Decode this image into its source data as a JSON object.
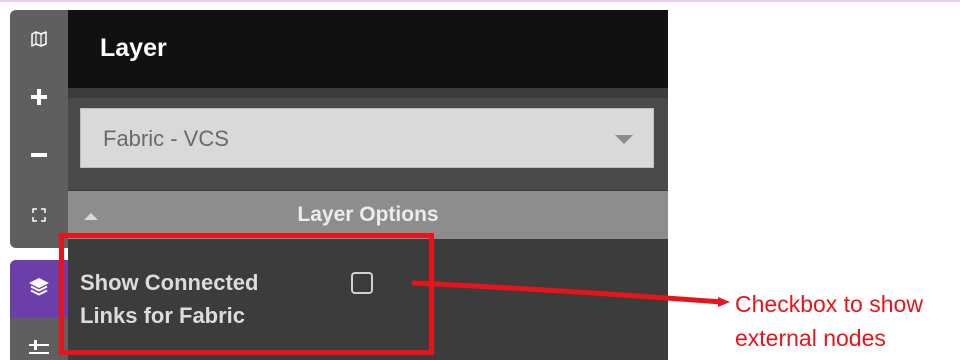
{
  "toolbar": {
    "icons": [
      "map-icon",
      "plus-icon",
      "minus-icon",
      "fullscreen-icon",
      "layers-icon",
      "sliders-icon"
    ]
  },
  "panel": {
    "title": "Layer",
    "layer_select": {
      "selected": "Fabric - VCS"
    },
    "section_title": "Layer Options",
    "options": [
      {
        "label": "Show Connected Links for Fabric",
        "checked": false
      }
    ]
  },
  "annotation": {
    "text": "Checkbox to show external nodes",
    "color": "#e8141b"
  },
  "colors": {
    "accent": "#6c3fa8",
    "panel_bg": "#3c3c3c",
    "header_bg": "#111111",
    "section_bg": "#8d8d8d"
  }
}
